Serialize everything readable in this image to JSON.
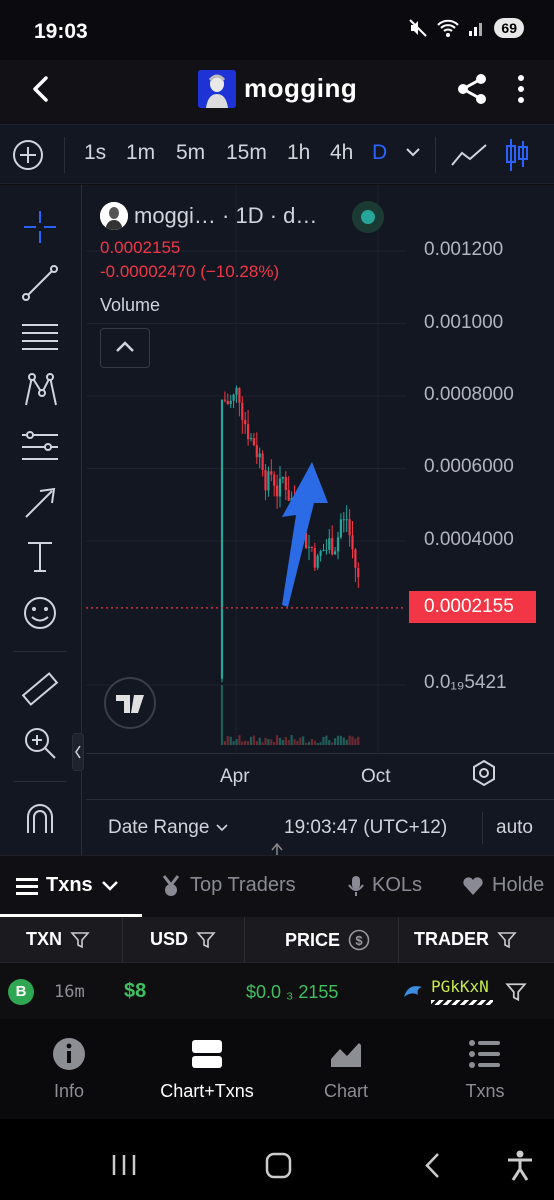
{
  "status": {
    "time": "19:03",
    "battery": "69"
  },
  "header": {
    "title": "mogging"
  },
  "timeframes": {
    "items": [
      "1s",
      "1m",
      "5m",
      "15m",
      "1h",
      "4h",
      "D"
    ],
    "active": "D"
  },
  "chart": {
    "legend_name": "moggi…  · 1D · d…",
    "price": "0.0002155",
    "change": "-0.00002470 (−10.28%)",
    "volume_label": "Volume",
    "current_price_tag": "0.0002155",
    "date_range_label": "Date Range",
    "clock": "19:03:47 (UTC+12)",
    "auto_label": "auto"
  },
  "chart_data": {
    "type": "candlestick",
    "title": "",
    "y_ticks": [
      "0.001200",
      "0.001000",
      "0.0008000",
      "0.0006000",
      "0.0004000",
      "0.0₁₉5421"
    ],
    "x_ticks": [
      "Apr",
      "Oct"
    ],
    "last_price": 0.0002155,
    "pump_high": 0.00079,
    "ylim": [
      0,
      0.00134
    ],
    "colors": {
      "up": "#26a69a",
      "down": "#f23645",
      "arrow": "#2b6be6"
    }
  },
  "tabs": [
    {
      "label": "Txns",
      "active": true
    },
    {
      "label": "Top Traders",
      "active": false
    },
    {
      "label": "KOLs",
      "active": false
    },
    {
      "label": "Holde",
      "active": false
    }
  ],
  "table": {
    "headers": [
      "TXN",
      "USD",
      "PRICE",
      "TRADER"
    ],
    "rows": [
      {
        "type": "B",
        "age": "16m",
        "usd": "$8",
        "price": "$0.0 ₃ 2155",
        "trader": "PGkKxN"
      }
    ]
  },
  "bottom_nav": [
    {
      "label": "Info",
      "icon": "info-icon"
    },
    {
      "label": "Chart+Txns",
      "icon": "chart-txns-icon",
      "active": true
    },
    {
      "label": "Chart",
      "icon": "area-chart-icon"
    },
    {
      "label": "Txns",
      "icon": "list-icon"
    }
  ]
}
